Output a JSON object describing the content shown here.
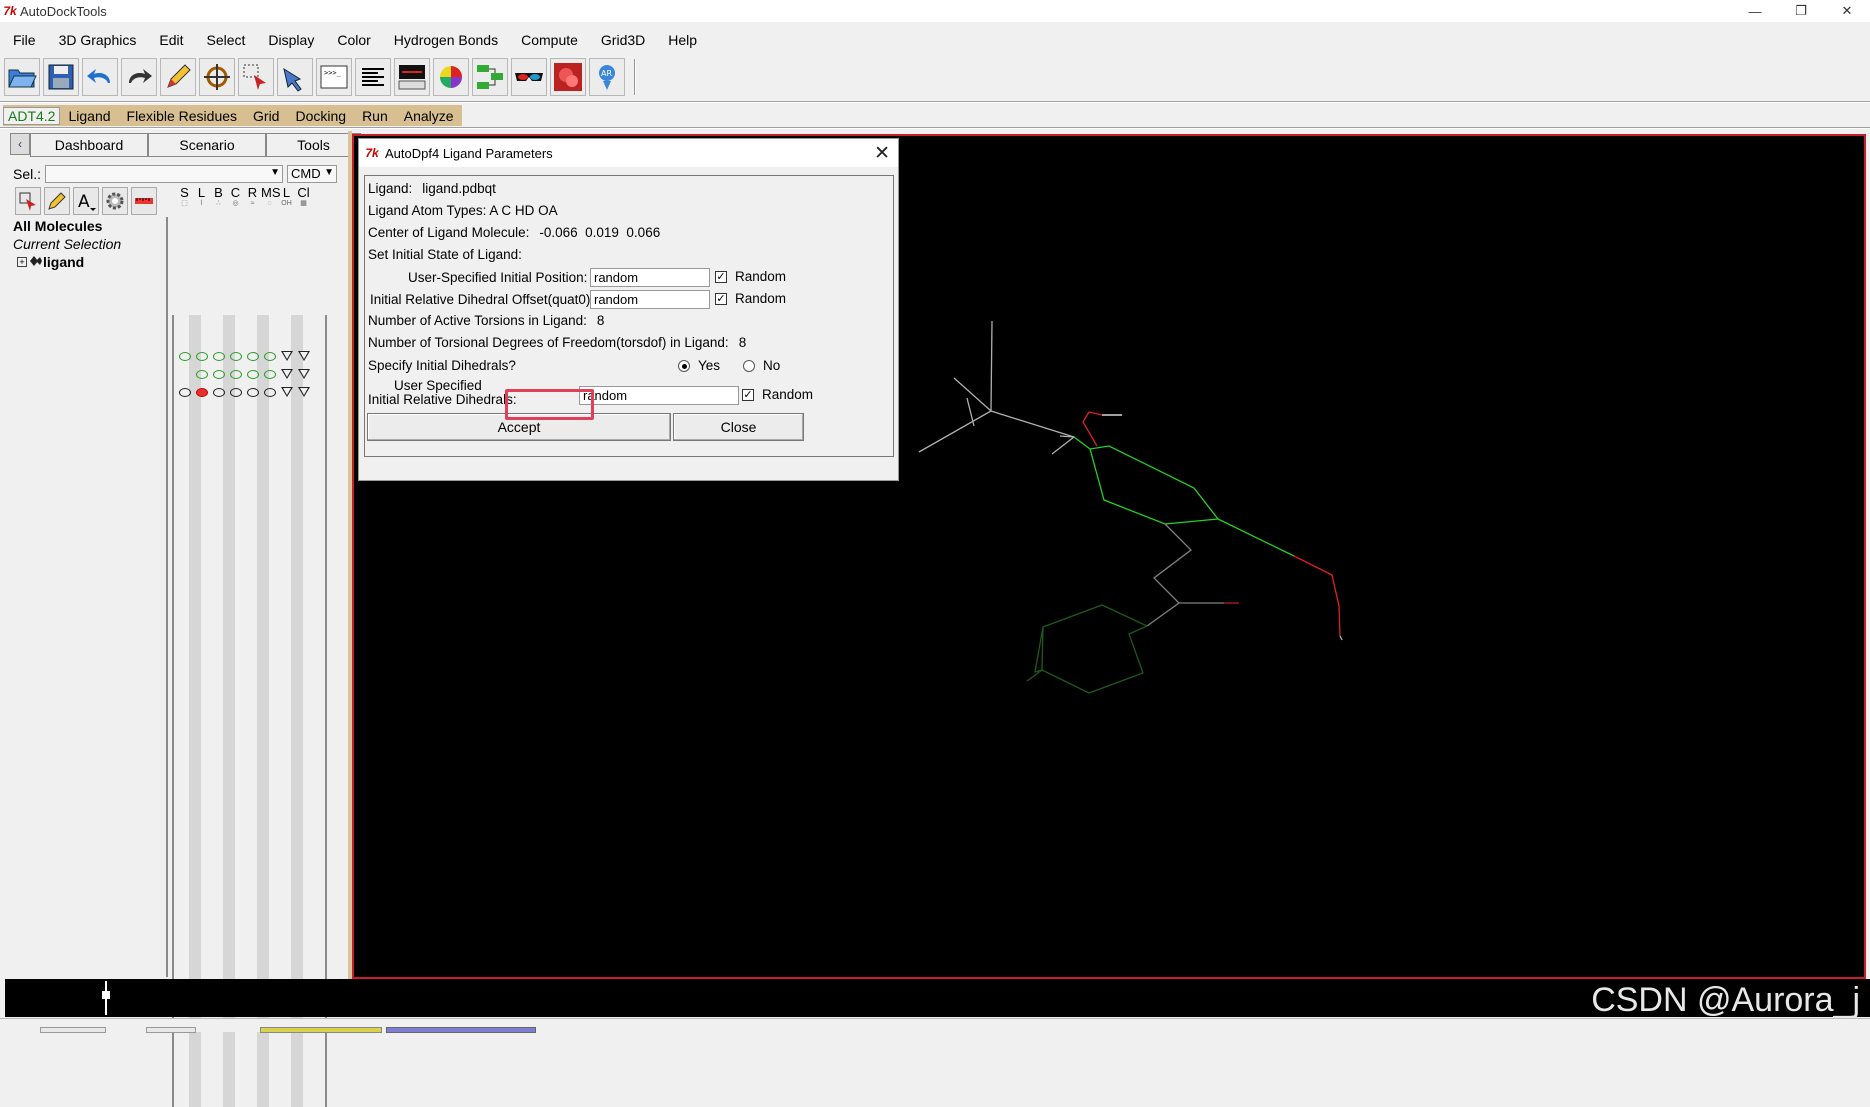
{
  "window": {
    "title": "AutoDockTools",
    "tk_logo": "7k",
    "controls": [
      "—",
      "❐",
      "✕"
    ]
  },
  "menubar": [
    "File",
    "3D Graphics",
    "Edit",
    "Select",
    "Display",
    "Color",
    "Hydrogen Bonds",
    "Compute",
    "Grid3D",
    "Help"
  ],
  "toolbar_icons": [
    "open-icon",
    "save-icon",
    "undo-icon",
    "redo-icon",
    "pencil-icon",
    "target-icon",
    "selection-icon",
    "pick-icon",
    "python-shell-icon",
    "text-align-icon",
    "monitor-icon",
    "color-sphere-icon",
    "network-icon",
    "3d-glasses-icon",
    "molecule-surface-icon",
    "ar-icon"
  ],
  "adt_menu": [
    "ADT4.2",
    "Ligand",
    "Flexible Residues",
    "Grid",
    "Docking",
    "Run",
    "Analyze"
  ],
  "dashboard": {
    "tabs": [
      "Dashboard",
      "Scenario",
      "Tools"
    ],
    "sel_label": "Sel.:",
    "cmd": "CMD",
    "columns": [
      {
        "h": "S",
        "sub": "⬚"
      },
      {
        "h": "L",
        "sub": "⌇"
      },
      {
        "h": "B",
        "sub": "∴"
      },
      {
        "h": "C",
        "sub": "◎"
      },
      {
        "h": "R",
        "sub": "≈"
      },
      {
        "h": "MS",
        "sub": "◌"
      },
      {
        "h": "L",
        "sub": "OH"
      },
      {
        "h": "Cl",
        "sub": "▦"
      }
    ],
    "tree": {
      "all_molecules": "All Molecules",
      "current_selection": "Current Selection",
      "ligand": "ligand"
    }
  },
  "dialog": {
    "title": "AutoDpf4 Ligand Parameters",
    "ligand_label": "Ligand:",
    "ligand_value": "ligand.pdbqt",
    "atom_types_label": "Ligand Atom Types:",
    "atom_types_value": "A C HD OA",
    "center_label": "Center of Ligand Molecule:",
    "center_value": "-0.066  0.019  0.066",
    "initial_state_label": "Set Initial State of Ligand:",
    "init_pos_label": "User-Specified Initial Position:",
    "init_pos_value": "random",
    "init_pos_random": "Random",
    "dihedral_offset_label": "Initial Relative Dihedral Offset(quat0):",
    "dihedral_offset_value": "random",
    "dihedral_offset_random": "Random",
    "active_torsions_label": "Number of Active Torsions in Ligand:",
    "active_torsions_value": "8",
    "torsdof_label": "Number of Torsional Degrees of Freedom(torsdof) in Ligand:",
    "torsdof_value": "8",
    "specify_dihedrals_label": "Specify Initial Dihedrals?",
    "yes": "Yes",
    "no": "No",
    "user_specified_line1": "User Specified",
    "user_specified_line2": "Initial Relative Dihedrals:",
    "dihedrals_value": "random",
    "dihedrals_random": "Random",
    "accept": "Accept",
    "close": "Close"
  },
  "watermark": "CSDN @Aurora_j",
  "colors": {
    "adt_bar": "#d8bf91",
    "viewer_border": "#c8202a",
    "highlight": "#e0405a",
    "bond_green": "#22d322",
    "bond_gray": "#b0b0b0",
    "bond_red": "#e02020",
    "bond_darkgreen": "#1d5a1d"
  }
}
